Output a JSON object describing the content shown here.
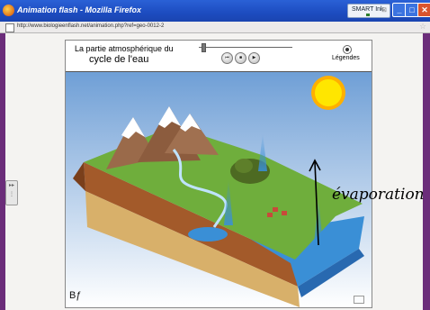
{
  "window": {
    "title": "Animation flash - Mozilla Firefox",
    "smart_ink": "SMART Ink",
    "min_label": "_",
    "max_label": "□",
    "close_label": "✕"
  },
  "address_bar": {
    "url": "http://www.biologieenflash.net/animation.php?ref=geo-0012-2"
  },
  "animation": {
    "title_line1": "La partie atmosphérique du",
    "title_line2": "cycle de l'eau",
    "legend_label": "Légendes",
    "credit": "Bƒ",
    "slider_value": 0.03,
    "controls": {
      "rewind": "⏮",
      "stop": "■",
      "play": "▶"
    }
  },
  "annotation": {
    "text": "évaporation"
  },
  "colors": {
    "desktop": "#6b2d7a",
    "titlebar": "#1d4cc0",
    "sky_top": "#6f9fd6",
    "sun": "#ffe600",
    "grass": "#6fae3c",
    "sea": "#3a8fd6"
  },
  "icons": {
    "app": "firefox-icon",
    "favicon": "page-icon",
    "bookmark": "star-icon",
    "sidebar": "sidebar-handle-icon",
    "mail": "mail-icon"
  }
}
